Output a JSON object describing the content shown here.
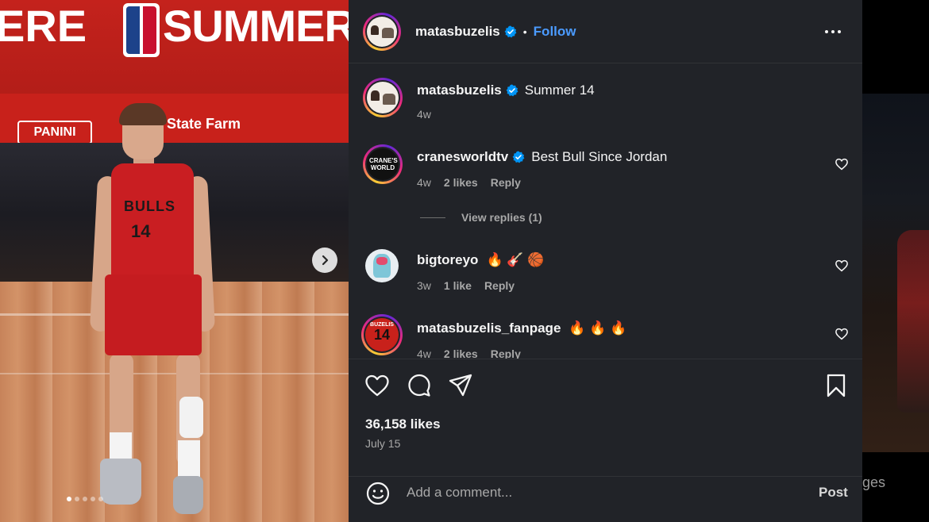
{
  "background_page": {
    "partial_text": "ges"
  },
  "photo": {
    "banner_left_text": "ERE",
    "banner_text": "SUMMER LEA",
    "ad_panini": "PANINI",
    "ad_statefarm": "State Farm",
    "jersey_text": "BULLS",
    "jersey_number": "14",
    "carousel_dots": 5,
    "active_dot": 0,
    "next_icon": "chevron-right-icon"
  },
  "post": {
    "author": "matasbuzelis",
    "verified": true,
    "separator": "•",
    "follow_label": "Follow",
    "more_icon": "more-options-icon",
    "caption": "Summer 14",
    "caption_time": "4w",
    "likes_label": "36,158 likes",
    "date": "July 15"
  },
  "comments": [
    {
      "user": "cranesworldtv",
      "verified": true,
      "text": "Best Bull Since Jordan",
      "time": "4w",
      "likes": "2 likes",
      "reply": "Reply",
      "avatar_text": "CRANE'S WORLD"
    },
    {
      "user": "bigtoreyo",
      "verified": false,
      "text": "🔥 🎸 🏀",
      "time": "3w",
      "likes": "1 like",
      "reply": "Reply"
    },
    {
      "user": "matasbuzelis_fanpage",
      "verified": false,
      "text": "🔥 🔥 🔥",
      "time": "4w",
      "likes": "2 likes",
      "reply": "Reply",
      "avatar_text": "BUZELIS",
      "avatar_num": "14"
    }
  ],
  "view_replies": "View replies (1)",
  "actions": {
    "like_icon": "heart-icon",
    "comment_icon": "comment-icon",
    "share_icon": "share-icon",
    "save_icon": "bookmark-icon"
  },
  "add_comment": {
    "placeholder": "Add a comment...",
    "post_label": "Post",
    "emoji_icon": "emoji-icon"
  },
  "colors": {
    "panel_bg": "#212328",
    "link_blue": "#4b9bff",
    "verified_blue": "#0095f6",
    "muted_text": "#a8a8a8"
  }
}
